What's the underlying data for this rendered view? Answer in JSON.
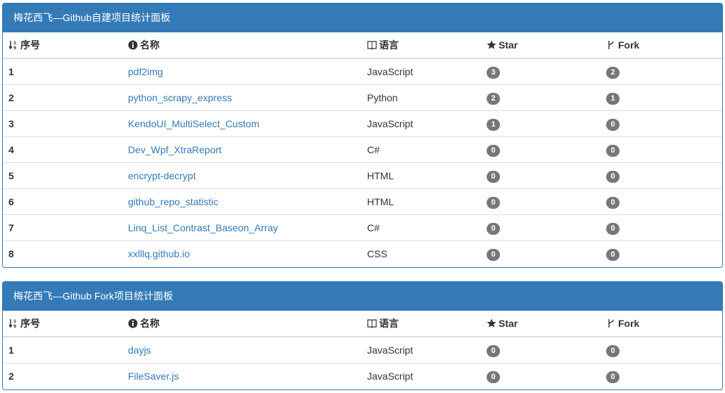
{
  "panels": [
    {
      "title": "梅花西飞—Github自建项目统计面板",
      "columns": [
        "序号",
        "名称",
        "语言",
        "Star",
        "Fork"
      ],
      "rows": [
        {
          "index": "1",
          "name": "pdf2img",
          "language": "JavaScript",
          "star": "3",
          "fork": "2"
        },
        {
          "index": "2",
          "name": "python_scrapy_express",
          "language": "Python",
          "star": "2",
          "fork": "1"
        },
        {
          "index": "3",
          "name": "KendoUI_MultiSelect_Custom",
          "language": "JavaScript",
          "star": "1",
          "fork": "0"
        },
        {
          "index": "4",
          "name": "Dev_Wpf_XtraReport",
          "language": "C#",
          "star": "0",
          "fork": "0"
        },
        {
          "index": "5",
          "name": "encrypt-decrypt",
          "language": "HTML",
          "star": "0",
          "fork": "0"
        },
        {
          "index": "6",
          "name": "github_repo_statistic",
          "language": "HTML",
          "star": "0",
          "fork": "0"
        },
        {
          "index": "7",
          "name": "Linq_List_Contrast_Baseon_Array",
          "language": "C#",
          "star": "0",
          "fork": "0"
        },
        {
          "index": "8",
          "name": "xxlllq.github.io",
          "language": "CSS",
          "star": "0",
          "fork": "0"
        }
      ]
    },
    {
      "title": "梅花西飞—Github Fork项目统计面板",
      "columns": [
        "序号",
        "名称",
        "语言",
        "Star",
        "Fork"
      ],
      "rows": [
        {
          "index": "1",
          "name": "dayjs",
          "language": "JavaScript",
          "star": "0",
          "fork": "0"
        },
        {
          "index": "2",
          "name": "FileSaver.js",
          "language": "JavaScript",
          "star": "0",
          "fork": "0"
        }
      ]
    }
  ],
  "header_icons": [
    "sort-numeric-icon",
    "info-circle-icon",
    "book-icon",
    "star-icon",
    "fork-icon"
  ],
  "colors": {
    "primary": "#337ab7",
    "badge": "#777777",
    "border": "#dddddd",
    "text": "#333333"
  }
}
